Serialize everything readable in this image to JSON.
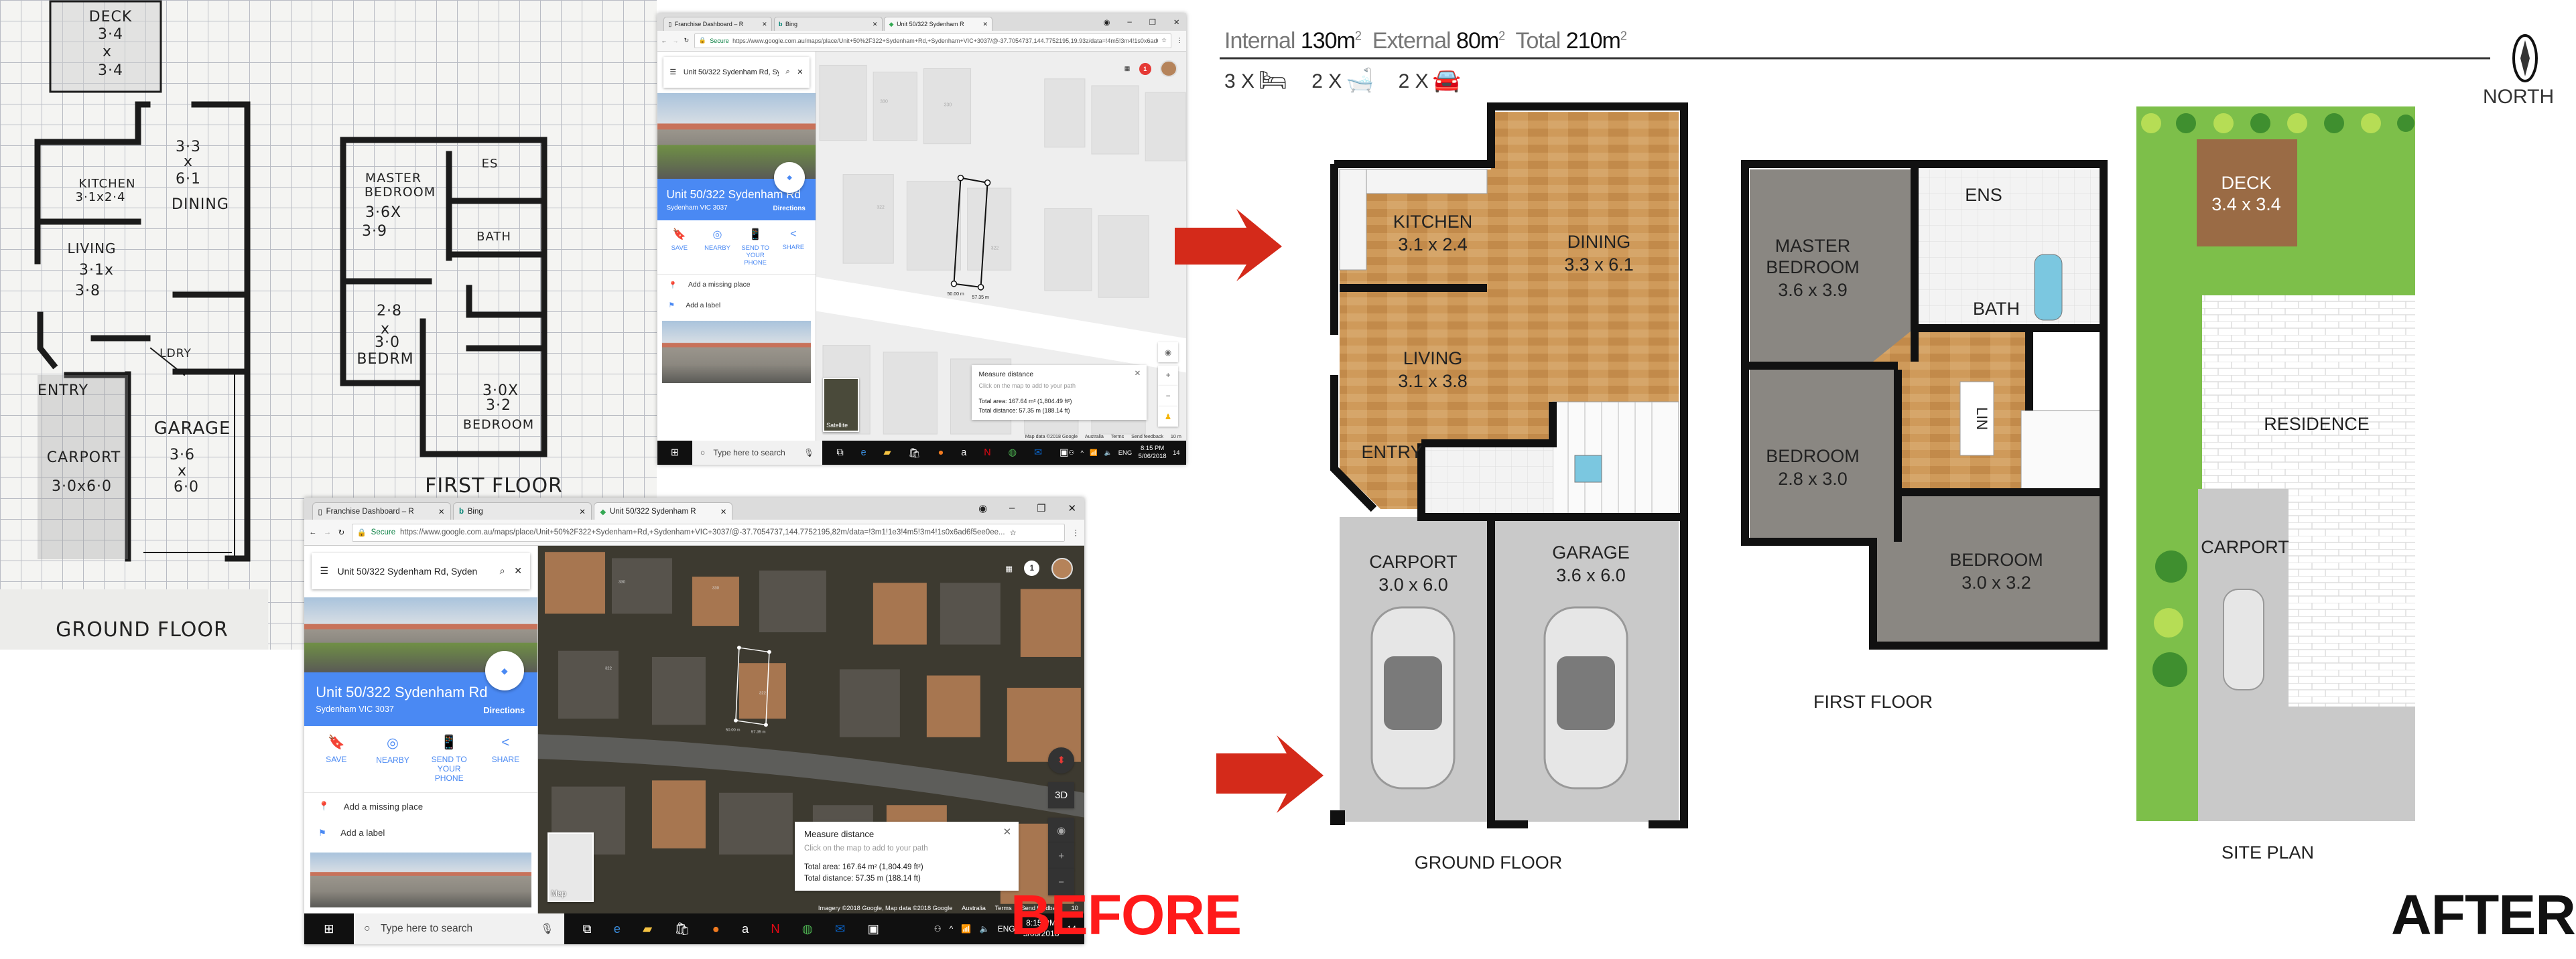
{
  "before_sketch": {
    "deck": {
      "label": "DECK",
      "w": "3·4",
      "x": "x",
      "h": "3·4"
    },
    "ground": {
      "dining_dims_1": "3·3",
      "dining_x": "x",
      "dining_dims_2": "6·1",
      "dining": "DINING",
      "kitchen": "KITCHEN",
      "kitchen_dims": "3·1x2·4",
      "living": "LIVING",
      "living_dims_1": "3·1x",
      "living_dims_2": "3·8",
      "laundry": "LDRY",
      "entry": "ENTRY",
      "carport": "CARPORT",
      "carport_dims": "3·0x6·0",
      "garage": "GARAGE",
      "garage_dims_1": "3·6",
      "garage_x": "x",
      "garage_dims_2": "6·0",
      "title": "GROUND FLOOR"
    },
    "first": {
      "master_1": "MASTER",
      "master_2": "BEDROOM",
      "master_dims_1": "3·6X",
      "master_dims_2": "3·9",
      "ensuite": "ES",
      "bath": "BATH",
      "bed2_dims_1": "2·8",
      "bed2_x": "x",
      "bed2_dims_2": "3·0",
      "bed2": "BEDRM",
      "bed3_dims_1": "3·0X",
      "bed3_dims_2": "3·2",
      "bed3": "BEDROOM",
      "title": "FIRST FLOOR"
    }
  },
  "browsers": [
    {
      "tabs": [
        "Franchise Dashboard – R",
        "Bing",
        "Unit 50/322 Sydenham R"
      ],
      "secure": "Secure",
      "url": "https://www.google.com.au/maps/place/Unit+50%2F322+Sydenham+Rd,+Sydenham+VIC+3037/@-37.7054737,144.7752195,19.93z/data=!4m5!3m4!1s0x6ad6f5ee0eeee18d:...",
      "search": "Unit 50/322 Sydenham Rd, Syden",
      "place_title": "Unit 50/322 Sydenham Rd",
      "place_sub": "Sydenham VIC 3037",
      "directions": "Directions",
      "actions": [
        "SAVE",
        "NEARBY",
        "SEND TO YOUR PHONE",
        "SHARE"
      ],
      "links": [
        "Add a missing place",
        "Add a label"
      ],
      "notifications": "1",
      "measure": {
        "title": "Measure distance",
        "hint": "Click on the map to add to your path",
        "area": "Total area: 167.64 m² (1,804.49 ft²)",
        "distance": "Total distance: 57.35 m (188.14 ft)"
      },
      "segment_labels": [
        "50.00 m",
        "57.35 m"
      ],
      "lot_numbers": [
        "330",
        "322"
      ],
      "layer_toggle": "Satellite",
      "footer": [
        "Map data ©2018 Google",
        "Australia",
        "Terms",
        "Send feedback",
        "10 m"
      ],
      "taskbar": {
        "search": "Type here to search",
        "lang": "ENG",
        "time": "8:15 PM",
        "date": "5/06/2018",
        "notif": "14"
      }
    },
    {
      "tabs": [
        "Franchise Dashboard – R",
        "Bing",
        "Unit 50/322 Sydenham R"
      ],
      "secure": "Secure",
      "url": "https://www.google.com.au/maps/place/Unit+50%2F322+Sydenham+Rd,+Sydenham+VIC+3037/@-37.7054737,144.7752195,82m/data=!3m1!1e3!4m5!3m4!1s0x6ad6f5ee0ee...",
      "search": "Unit 50/322 Sydenham Rd, Syden",
      "place_title": "Unit 50/322 Sydenham Rd",
      "place_sub": "Sydenham VIC 3037",
      "directions": "Directions",
      "actions": [
        "SAVE",
        "NEARBY",
        "SEND TO YOUR PHONE",
        "SHARE"
      ],
      "links": [
        "Add a missing place",
        "Add a label"
      ],
      "notifications": "1",
      "measure": {
        "title": "Measure distance",
        "hint": "Click on the map to add to your path",
        "area": "Total area: 167.64 m² (1,804.49 ft²)",
        "distance": "Total distance: 57.35 m (188.14 ft)"
      },
      "segment_labels": [
        "50.00 m",
        "57.35 m"
      ],
      "lot_numbers": [
        "330",
        "322"
      ],
      "layer_toggle": "Map",
      "view_3d": "3D",
      "footer": [
        "Imagery ©2018 Google, Map data ©2018 Google",
        "Australia",
        "Terms",
        "Send feedback",
        "10"
      ],
      "taskbar": {
        "search": "Type here to search",
        "lang": "ENG",
        "time": "8:15 PM",
        "date": "5/06/2018",
        "notif": "14"
      }
    }
  ],
  "before_label": "BEFORE",
  "after_label": "AFTER",
  "after": {
    "areas": {
      "internal_label": "Internal",
      "internal": "130m",
      "external_label": "External",
      "external": "80m",
      "total_label": "Total",
      "total": "210m",
      "sup": "2"
    },
    "counts": [
      {
        "count": "3 X",
        "icon": "bed-icon"
      },
      {
        "count": "2 X",
        "icon": "bathtub-icon"
      },
      {
        "count": "2 X",
        "icon": "car-icon"
      }
    ],
    "north": "NORTH",
    "ground_floor": {
      "title": "GROUND FLOOR",
      "rooms": [
        {
          "name": "KITCHEN",
          "dims": "3.1 x 2.4"
        },
        {
          "name": "DINING",
          "dims": "3.3 x 6.1"
        },
        {
          "name": "LIVING",
          "dims": "3.1 x 3.8"
        },
        {
          "name": "ENTRY"
        },
        {
          "name": "CARPORT",
          "dims": "3.0 x 6.0"
        },
        {
          "name": "GARAGE",
          "dims": "3.6 x 6.0"
        }
      ]
    },
    "first_floor": {
      "title": "FIRST FLOOR",
      "rooms": [
        {
          "name": "MASTER",
          "name2": "BEDROOM",
          "dims": "3.6 x 3.9"
        },
        {
          "name": "ENS"
        },
        {
          "name": "BATH"
        },
        {
          "name": "LIN"
        },
        {
          "name": "BEDROOM",
          "dims": "2.8 x 3.0"
        },
        {
          "name": "BEDROOM",
          "dims": "3.0 x 3.2"
        }
      ]
    },
    "site_plan": {
      "title": "SITE PLAN",
      "deck": "DECK",
      "deck_dims": "3.4 x 3.4",
      "residence": "RESIDENCE",
      "carport": "CARPORT"
    }
  },
  "colors": {
    "wood": "#c8914f",
    "carpet": "#8a8782",
    "concrete": "#c9c9c9",
    "grass": "#7dbf4a",
    "arrow": "#d42a1a",
    "maps_blue": "#4a89f3",
    "before_red": "#ff1a1a"
  }
}
